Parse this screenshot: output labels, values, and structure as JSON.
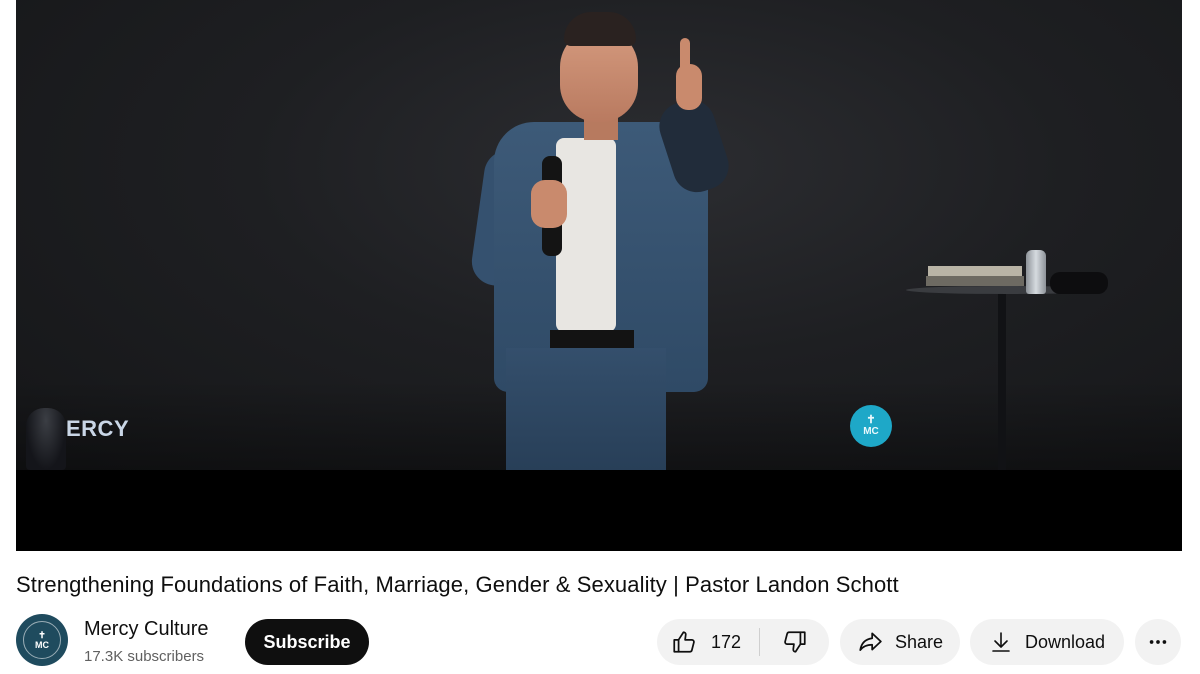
{
  "video": {
    "stage_sign_text": "ERCY",
    "badge_text": "MC",
    "title": "Strengthening Foundations of Faith, Marriage, Gender & Sexuality | Pastor Landon Schott"
  },
  "channel": {
    "name": "Mercy Culture",
    "subscribers": "17.3K subscribers",
    "avatar_text": "MC",
    "subscribe_label": "Subscribe"
  },
  "actions": {
    "like_count": "172",
    "share_label": "Share",
    "download_label": "Download"
  },
  "icons": {
    "like": "thumbs-up-icon",
    "dislike": "thumbs-down-icon",
    "share": "share-arrow-icon",
    "download": "download-icon",
    "more": "more-horizontal-icon"
  },
  "colors": {
    "subscribe_bg": "#0f0f0f",
    "pill_bg": "#f2f2f2",
    "badge_teal": "#1ea8c8",
    "secondary_text": "#606060"
  }
}
